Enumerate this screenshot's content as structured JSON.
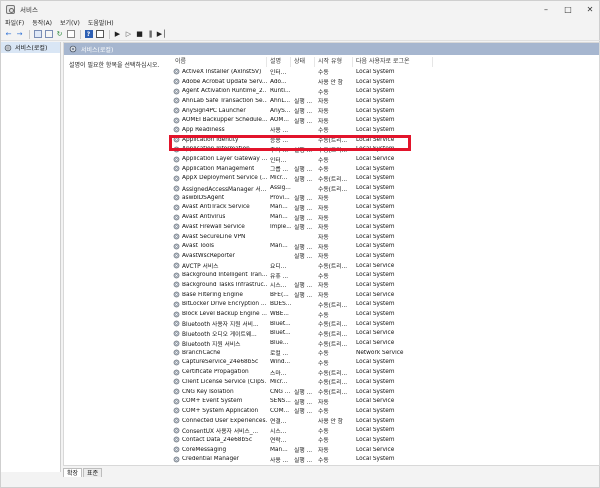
{
  "window": {
    "title": "서비스",
    "controls": [
      "–",
      "□",
      "✕"
    ]
  },
  "menu": [
    "파일(F)",
    "동작(A)",
    "보기(V)",
    "도움말(H)"
  ],
  "toolbar": [
    "back-icon",
    "forward-icon",
    "console-icon",
    "list-icon",
    "refresh-icon",
    "export-icon",
    "help-icon",
    "properties-icon",
    "play-icon",
    "play-outline-icon",
    "stop-icon",
    "pause-icon",
    "restart-icon"
  ],
  "tree": {
    "root": "서비스(로컬)"
  },
  "panel": {
    "header": "서비스(로컬)",
    "description": "설명이 필요한 항목을 선택하십시오."
  },
  "columns": {
    "name": "이름",
    "desc": "설명",
    "status": "상태",
    "startup": "시작 유형",
    "logon": "다음 사용자로 로그온"
  },
  "services": [
    {
      "name": "ActiveX Installer (AxInstSV)",
      "desc": "인터...",
      "status": "",
      "startup": "수동",
      "logon": "Local System"
    },
    {
      "name": "Adobe Acrobat Update Serv...",
      "desc": "Ado...",
      "status": "",
      "startup": "사용 안 함",
      "logon": "Local System"
    },
    {
      "name": "Agent Activation Runtime_2...",
      "desc": "Runti...",
      "status": "",
      "startup": "수동",
      "logon": "Local System"
    },
    {
      "name": "AhnLab Safe Transaction Se...",
      "desc": "AhnL...",
      "status": "실행 ...",
      "startup": "자동",
      "logon": "Local System"
    },
    {
      "name": "AnySign4PC Launcher",
      "desc": "AnyS...",
      "status": "실행 ...",
      "startup": "자동",
      "logon": "Local System"
    },
    {
      "name": "AOMEI Backupper Schedule...",
      "desc": "AOM...",
      "status": "실행 ...",
      "startup": "자동",
      "logon": "Local System"
    },
    {
      "name": "App Readiness",
      "desc": "사용 ...",
      "status": "",
      "startup": "수동",
      "logon": "Local System"
    },
    {
      "name": "Application Identity",
      "desc": "응용 ...",
      "status": "",
      "startup": "수동(트리...",
      "logon": "Local Service"
    },
    {
      "name": "Application Information",
      "desc": "추가 ...",
      "status": "실행 ...",
      "startup": "수동(트리...",
      "logon": "Local System"
    },
    {
      "name": "Application Layer Gateway ...",
      "desc": "인터...",
      "status": "",
      "startup": "수동",
      "logon": "Local Service"
    },
    {
      "name": "Application Management",
      "desc": "그룹 ...",
      "status": "실행 ...",
      "startup": "수동",
      "logon": "Local System"
    },
    {
      "name": "AppX Deployment Service (...",
      "desc": "Micr...",
      "status": "실행 ...",
      "startup": "수동(트리...",
      "logon": "Local System"
    },
    {
      "name": "AssignedAccessManager 서...",
      "desc": "Assig...",
      "status": "",
      "startup": "수동(트리...",
      "logon": "Local System"
    },
    {
      "name": "aswbIDSAgent",
      "desc": "Provi...",
      "status": "실행 ...",
      "startup": "자동",
      "logon": "Local System"
    },
    {
      "name": "Avast AntiTrack Service",
      "desc": "Man...",
      "status": "실행 ...",
      "startup": "자동",
      "logon": "Local System"
    },
    {
      "name": "Avast Antivirus",
      "desc": "Man...",
      "status": "실행 ...",
      "startup": "자동",
      "logon": "Local System"
    },
    {
      "name": "Avast Firewall Service",
      "desc": "Imple...",
      "status": "실행 ...",
      "startup": "자동",
      "logon": "Local System"
    },
    {
      "name": "Avast SecureLine VPN",
      "desc": "",
      "status": "",
      "startup": "자동",
      "logon": "Local System"
    },
    {
      "name": "Avast Tools",
      "desc": "Man...",
      "status": "실행 ...",
      "startup": "자동",
      "logon": "Local System"
    },
    {
      "name": "AvastWscReporter",
      "desc": "",
      "status": "실행 ...",
      "startup": "자동",
      "logon": "Local System"
    },
    {
      "name": "AVCTP 서비스",
      "desc": "요디...",
      "status": "",
      "startup": "수동(트리...",
      "logon": "Local Service"
    },
    {
      "name": "Background Intelligent Tran...",
      "desc": "유휴 ...",
      "status": "",
      "startup": "수동",
      "logon": "Local System"
    },
    {
      "name": "Background Tasks Infrastruc...",
      "desc": "시스...",
      "status": "실행 ...",
      "startup": "자동",
      "logon": "Local System"
    },
    {
      "name": "Base Filtering Engine",
      "desc": "BFE(...",
      "status": "실행 ...",
      "startup": "자동",
      "logon": "Local Service"
    },
    {
      "name": "BitLocker Drive Encryption ...",
      "desc": "BDES...",
      "status": "",
      "startup": "수동(트리...",
      "logon": "Local System"
    },
    {
      "name": "Block Level Backup Engine ...",
      "desc": "WBE...",
      "status": "",
      "startup": "수동",
      "logon": "Local System"
    },
    {
      "name": "Bluetooth 사용자 지원 서비...",
      "desc": "Bluet...",
      "status": "",
      "startup": "수동(트리...",
      "logon": "Local System"
    },
    {
      "name": "Bluetooth 오디오 게이트웨...",
      "desc": "Bluet...",
      "status": "",
      "startup": "수동(트리...",
      "logon": "Local Service"
    },
    {
      "name": "Bluetooth 지원 서비스",
      "desc": "Blue...",
      "status": "",
      "startup": "수동(트리...",
      "logon": "Local Service"
    },
    {
      "name": "BranchCache",
      "desc": "로컬 ...",
      "status": "",
      "startup": "수동",
      "logon": "Network Service"
    },
    {
      "name": "CaptureService_24e68b5c",
      "desc": "Wind...",
      "status": "",
      "startup": "수동",
      "logon": "Local System"
    },
    {
      "name": "Certificate Propagation",
      "desc": "스마...",
      "status": "",
      "startup": "수동(트리...",
      "logon": "Local System"
    },
    {
      "name": "Client License Service (ClipS...",
      "desc": "Micr...",
      "status": "",
      "startup": "수동(트리...",
      "logon": "Local System"
    },
    {
      "name": "CNG Key Isolation",
      "desc": "CNG ...",
      "status": "실행 ...",
      "startup": "수동(트리...",
      "logon": "Local System"
    },
    {
      "name": "COM+ Event System",
      "desc": "SENS...",
      "status": "실행 ...",
      "startup": "자동",
      "logon": "Local Service"
    },
    {
      "name": "COM+ System Application",
      "desc": "COM...",
      "status": "실행 ...",
      "startup": "수동",
      "logon": "Local System"
    },
    {
      "name": "Connected User Experiences...",
      "desc": "연결...",
      "status": "",
      "startup": "사용 안 함",
      "logon": "Local System"
    },
    {
      "name": "ConsentUX 사용자 서비스_...",
      "desc": "시스...",
      "status": "",
      "startup": "수동",
      "logon": "Local System"
    },
    {
      "name": "Contact Data_24e68b5c",
      "desc": "연락...",
      "status": "",
      "startup": "수동",
      "logon": "Local System"
    },
    {
      "name": "CoreMessaging",
      "desc": "Man...",
      "status": "실행 ...",
      "startup": "자동",
      "logon": "Local Service"
    },
    {
      "name": "Credential Manager",
      "desc": "사용 ...",
      "status": "실행 ...",
      "startup": "수동",
      "logon": "Local System"
    }
  ],
  "tabs": [
    "확장",
    "표준"
  ]
}
